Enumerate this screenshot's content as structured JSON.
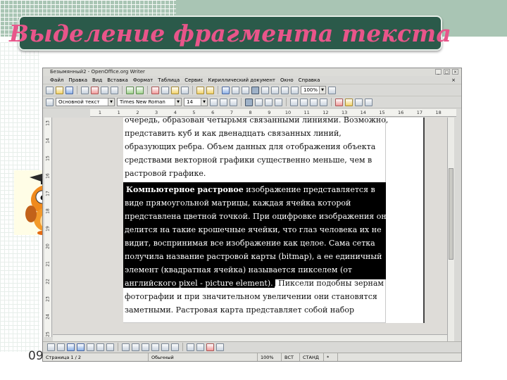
{
  "slide": {
    "title": "Выделение фрагмента текста",
    "slide_number": "09"
  },
  "window": {
    "title": "Безымянный2 - OpenOffice.org Writer",
    "controls": [
      "_",
      "□",
      "×"
    ],
    "doc_close": "×"
  },
  "menu": {
    "items": [
      "Файл",
      "Правка",
      "Вид",
      "Вставка",
      "Формат",
      "Таблица",
      "Сервис",
      "Кириллический документ",
      "Окно",
      "Справка"
    ]
  },
  "toolbar": {
    "zoom": "100%"
  },
  "format_bar": {
    "style": "Основной текст",
    "font": "Times New Roman",
    "size": "14"
  },
  "ruler": {
    "ticks": [
      "1",
      "1",
      "2",
      "3",
      "4",
      "5",
      "6",
      "7",
      "8",
      "9",
      "10",
      "11",
      "12",
      "13",
      "14",
      "15",
      "16",
      "17",
      "18"
    ],
    "vticks": [
      "13",
      "14",
      "15",
      "16",
      "17",
      "18",
      "19",
      "20",
      "21",
      "22",
      "23",
      "24",
      "25"
    ]
  },
  "document": {
    "lines_before": [
      "очередь, образован четырьмя связанными линиями. Возможно,",
      "представить куб и как двенадцать связанных линий,",
      "образующих ребра.  Объем данных для отображения объекта",
      "средствами векторной графики существенно меньше, чем в",
      "растровой графике."
    ],
    "selected_first_bold": "Компьютерное растровое",
    "selected_first_rest": " изображение представляется в",
    "selected_lines": [
      "виде прямоугольной матрицы, каждая ячейка которой",
      "представлена цветной точкой. При оцифровке изображения оно",
      "делится на такие крошечные ячейки, что глаз человека их не",
      "видит, воспринимая все изображение как целое. Сама сетка",
      "получила название растровой карты (bitmap), а ее единичный",
      "элемент (квадратная ячейка) называется пикселем (от"
    ],
    "partial_selected": "английского pixel - picture element).",
    "partial_rest": " Пиксели подобны зернам",
    "lines_after": [
      "фотографии и при значительном увеличении они становятся",
      "заметными. Растровая карта представляет собой набор"
    ]
  },
  "status": {
    "page": "Страница  1 / 2",
    "style": "Обычный",
    "zoom": "100%",
    "ins": "ВСТ",
    "std": "СТАНД",
    "sel": "*"
  }
}
